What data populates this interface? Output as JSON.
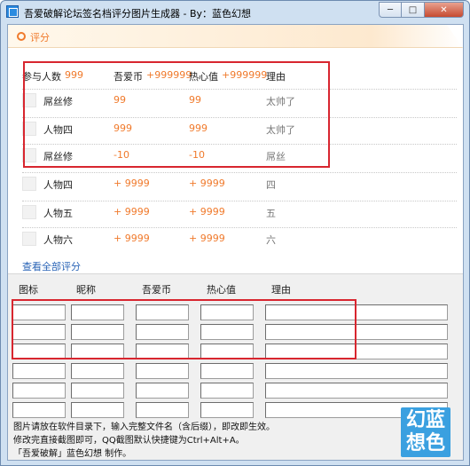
{
  "window": {
    "title": "吾爱破解论坛签名档评分图片生成器 - By：蓝色幻想",
    "minimize": "─",
    "maximize": "□",
    "close": "✕"
  },
  "score": {
    "title": "评分",
    "header": {
      "participants_label": "参与人数",
      "participants_value": "999",
      "coin_label": "吾爱币",
      "coin_value": "+999999",
      "heat_label": "热心值",
      "heat_value": "+999999",
      "reason_label": "理由"
    },
    "rows": [
      {
        "name": "屌丝修",
        "coin": "99",
        "heat": "99",
        "reason": "太帅了"
      },
      {
        "name": "人物四",
        "coin": "999",
        "heat": "999",
        "reason": "太帅了"
      },
      {
        "name": "屌丝修",
        "coin": "-10",
        "heat": "-10",
        "reason": "屌丝"
      },
      {
        "name": "人物四",
        "coin": "+ 9999",
        "heat": "+ 9999",
        "reason": "四"
      },
      {
        "name": "人物五",
        "coin": "+ 9999",
        "heat": "+ 9999",
        "reason": "五"
      },
      {
        "name": "人物六",
        "coin": "+ 9999",
        "heat": "+ 9999",
        "reason": "六"
      }
    ],
    "view_all": "查看全部评分"
  },
  "form": {
    "headers": [
      "图标",
      "昵称",
      "吾爱币",
      "热心值",
      "理由"
    ]
  },
  "hints": {
    "line1": "图片请放在软件目录下，输入完整文件名（含后缀），即改即生效。",
    "line2": "修改完直接截图即可，QQ截图默认快捷键为Ctrl+Alt+A。",
    "line3": "「吾爱破解」蓝色幻想 制作。"
  },
  "logo": {
    "line1": "幻蓝",
    "line2": "想色",
    "color": "#3aa0e0"
  },
  "colors": {
    "accent": "#f07a2c",
    "link": "#2a64b6",
    "highlight": "#d8262f"
  }
}
